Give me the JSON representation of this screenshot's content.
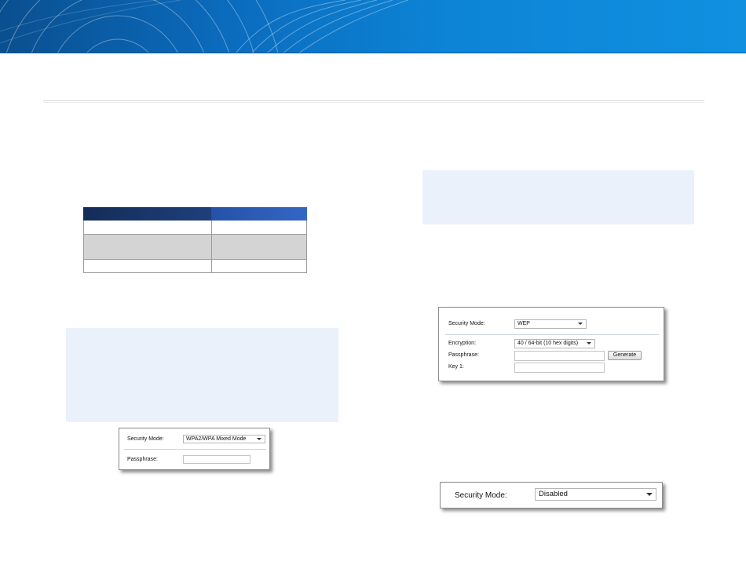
{
  "colors": {
    "banner": "#0d84d6",
    "table_header_dark": "#1f3f7c",
    "table_header_light": "#3466c4",
    "note_bg": "#eaf1fb",
    "row_shaded": "#d4d4d4"
  },
  "panel_wpa": {
    "security_mode_label": "Security Mode:",
    "security_mode_value": "WPA2/WPA Mixed Mode",
    "passphrase_label": "Passphrase:",
    "passphrase_value": ""
  },
  "panel_wep": {
    "security_mode_label": "Security Mode:",
    "security_mode_value": "WEP",
    "encryption_label": "Encryption:",
    "encryption_value": "40 / 64-bit (10 hex digits)",
    "passphrase_label": "Passphrase:",
    "passphrase_value": "",
    "generate_label": "Generate",
    "key1_label": "Key 1:",
    "key1_value": ""
  },
  "panel_disabled": {
    "security_mode_label": "Security Mode:",
    "security_mode_value": "Disabled"
  }
}
